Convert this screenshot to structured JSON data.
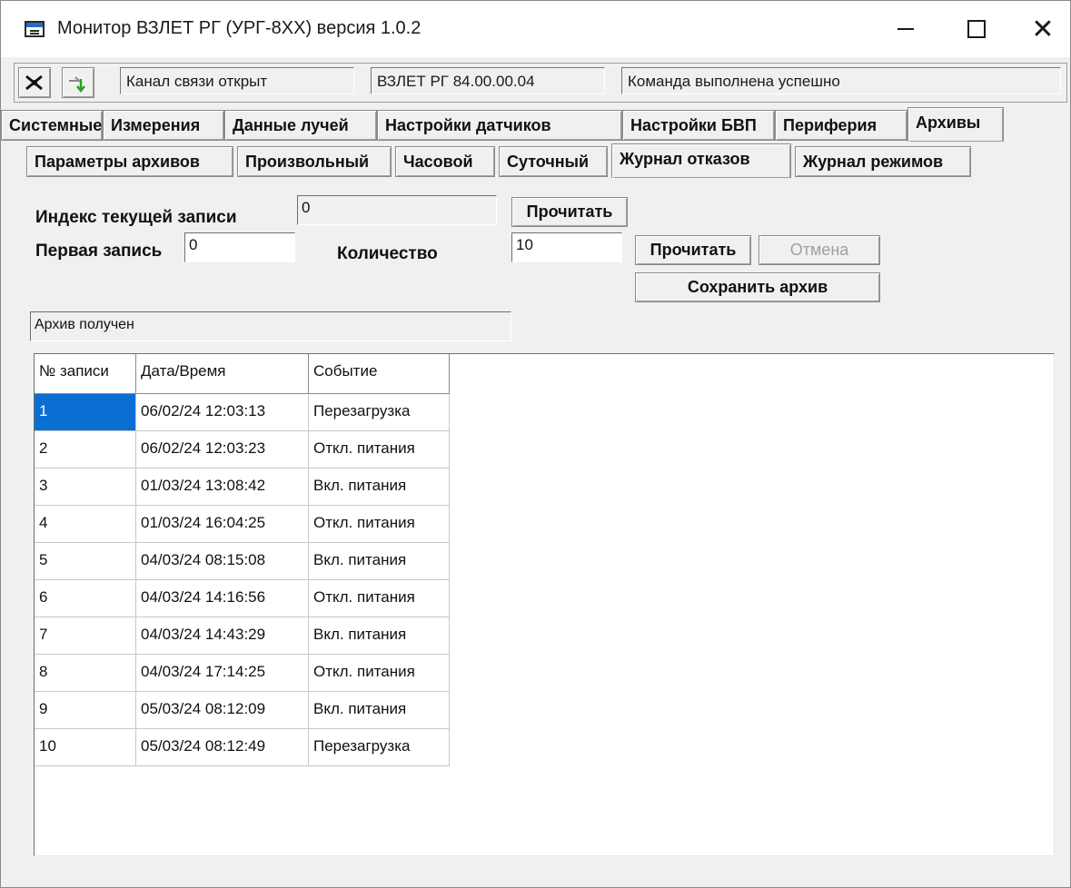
{
  "window": {
    "title": "Монитор ВЗЛЕТ РГ (УРГ-8XX) версия 1.0.2"
  },
  "toolbar": {
    "status_channel": "Канал связи открыт",
    "device_version": "ВЗЛЕТ РГ 84.00.00.04",
    "command_status": "Команда выполнена успешно",
    "disconnect_icon": "plug-icon",
    "connect_icon": "connect-arrow-icon"
  },
  "tabs": [
    "Системные",
    "Измерения",
    "Данные лучей",
    "Настройки датчиков",
    "Настройки БВП",
    "Периферия",
    "Архивы"
  ],
  "subtabs": [
    "Параметры архивов",
    "Произвольный",
    "Часовой",
    "Суточный",
    "Журнал отказов",
    "Журнал режимов"
  ],
  "form": {
    "current_index_label": "Индекс текущей записи",
    "current_index_value": "0",
    "read_button": "Прочитать",
    "first_record_label": "Первая запись",
    "first_record_value": "0",
    "count_label": "Количество",
    "count_value": "10",
    "read_button2": "Прочитать",
    "cancel_button": "Отмена",
    "save_button": "Сохранить архив",
    "status_message": "Архив получен"
  },
  "table": {
    "headers": [
      "№ записи",
      "Дата/Время",
      "Событие"
    ],
    "rows": [
      [
        "1",
        "06/02/24 12:03:13",
        "Перезагрузка"
      ],
      [
        "2",
        "06/02/24 12:03:23",
        "Откл. питания"
      ],
      [
        "3",
        "01/03/24 13:08:42",
        "Вкл. питания"
      ],
      [
        "4",
        "01/03/24 16:04:25",
        "Откл. питания"
      ],
      [
        "5",
        "04/03/24 08:15:08",
        "Вкл. питания"
      ],
      [
        "6",
        "04/03/24 14:16:56",
        "Откл. питания"
      ],
      [
        "7",
        "04/03/24 14:43:29",
        "Вкл. питания"
      ],
      [
        "8",
        "04/03/24 17:14:25",
        "Откл. питания"
      ],
      [
        "9",
        "05/03/24 08:12:09",
        "Вкл. питания"
      ],
      [
        "10",
        "05/03/24 08:12:49",
        "Перезагрузка"
      ]
    ]
  },
  "colors": {
    "selection": "#0a6fd3",
    "background": "#f0f0f0"
  }
}
